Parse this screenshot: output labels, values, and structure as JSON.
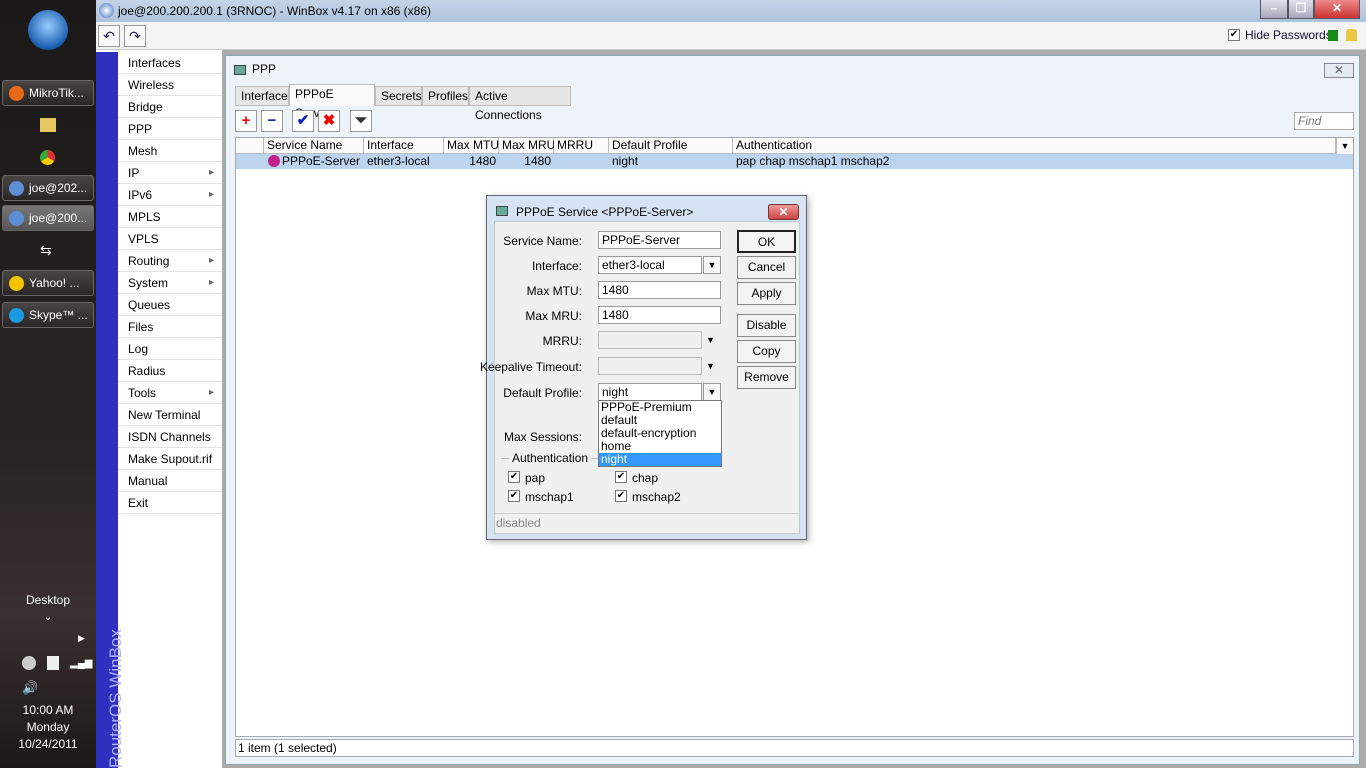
{
  "taskbar": {
    "buttons": [
      {
        "label": "MikroTik...",
        "icon": "firefox-icon"
      },
      {
        "label": "joe@202...",
        "icon": "winbox-icon"
      },
      {
        "label": "joe@200...",
        "icon": "winbox-icon"
      },
      {
        "label": "Yahoo! ...",
        "icon": "yahoo-icon"
      },
      {
        "label": "Skype™ ...",
        "icon": "skype-icon"
      }
    ],
    "desktop_label": "Desktop",
    "time": "10:00 AM",
    "day": "Monday",
    "date": "10/24/2011"
  },
  "window": {
    "title": "joe@200.200.200.1 (3RNOC) - WinBox v4.17 on x86 (x86)",
    "hide_passwords_label": "Hide Passwords",
    "hide_passwords_checked": true,
    "brand": "RouterOS WinBox"
  },
  "menu": [
    {
      "label": "Interfaces"
    },
    {
      "label": "Wireless"
    },
    {
      "label": "Bridge"
    },
    {
      "label": "PPP"
    },
    {
      "label": "Mesh"
    },
    {
      "label": "IP",
      "sub": true
    },
    {
      "label": "IPv6",
      "sub": true
    },
    {
      "label": "MPLS"
    },
    {
      "label": "VPLS"
    },
    {
      "label": "Routing",
      "sub": true
    },
    {
      "label": "System",
      "sub": true
    },
    {
      "label": "Queues"
    },
    {
      "label": "Files"
    },
    {
      "label": "Log"
    },
    {
      "label": "Radius"
    },
    {
      "label": "Tools",
      "sub": true
    },
    {
      "label": "New Terminal"
    },
    {
      "label": "ISDN Channels"
    },
    {
      "label": "Make Supout.rif"
    },
    {
      "label": "Manual"
    },
    {
      "label": "Exit"
    }
  ],
  "ppp": {
    "title": "PPP",
    "tabs": [
      "Interface",
      "PPPoE Servers",
      "Secrets",
      "Profiles",
      "Active Connections"
    ],
    "active_tab": "PPPoE Servers",
    "find_placeholder": "Find",
    "columns": [
      "Service Name",
      "Interface",
      "Max MTU",
      "Max MRU",
      "MRRU",
      "Default Profile",
      "Authentication"
    ],
    "rows": [
      [
        "PPPoE-Server",
        "ether3-local",
        "1480",
        "1480",
        "",
        "night",
        "pap chap mschap1 mschap2"
      ]
    ],
    "status": "1 item (1 selected)"
  },
  "dialog": {
    "title": "PPPoE Service <PPPoE-Server>",
    "fields": {
      "service_name_label": "Service Name:",
      "service_name": "PPPoE-Server",
      "interface_label": "Interface:",
      "interface": "ether3-local",
      "max_mtu_label": "Max MTU:",
      "max_mtu": "1480",
      "max_mru_label": "Max MRU:",
      "max_mru": "1480",
      "mrru_label": "MRRU:",
      "keepalive_label": "Keepalive Timeout:",
      "default_profile_label": "Default Profile:",
      "default_profile": "night",
      "max_sessions_label": "Max Sessions:"
    },
    "profile_options": [
      "PPPoE-Premium",
      "default",
      "default-encryption",
      "home",
      "night"
    ],
    "auth_label": "Authentication",
    "auth": [
      {
        "label": "pap",
        "checked": true
      },
      {
        "label": "chap",
        "checked": true
      },
      {
        "label": "mschap1",
        "checked": true
      },
      {
        "label": "mschap2",
        "checked": true
      }
    ],
    "buttons": [
      "OK",
      "Cancel",
      "Apply",
      "Disable",
      "Copy",
      "Remove"
    ],
    "status": "disabled"
  }
}
